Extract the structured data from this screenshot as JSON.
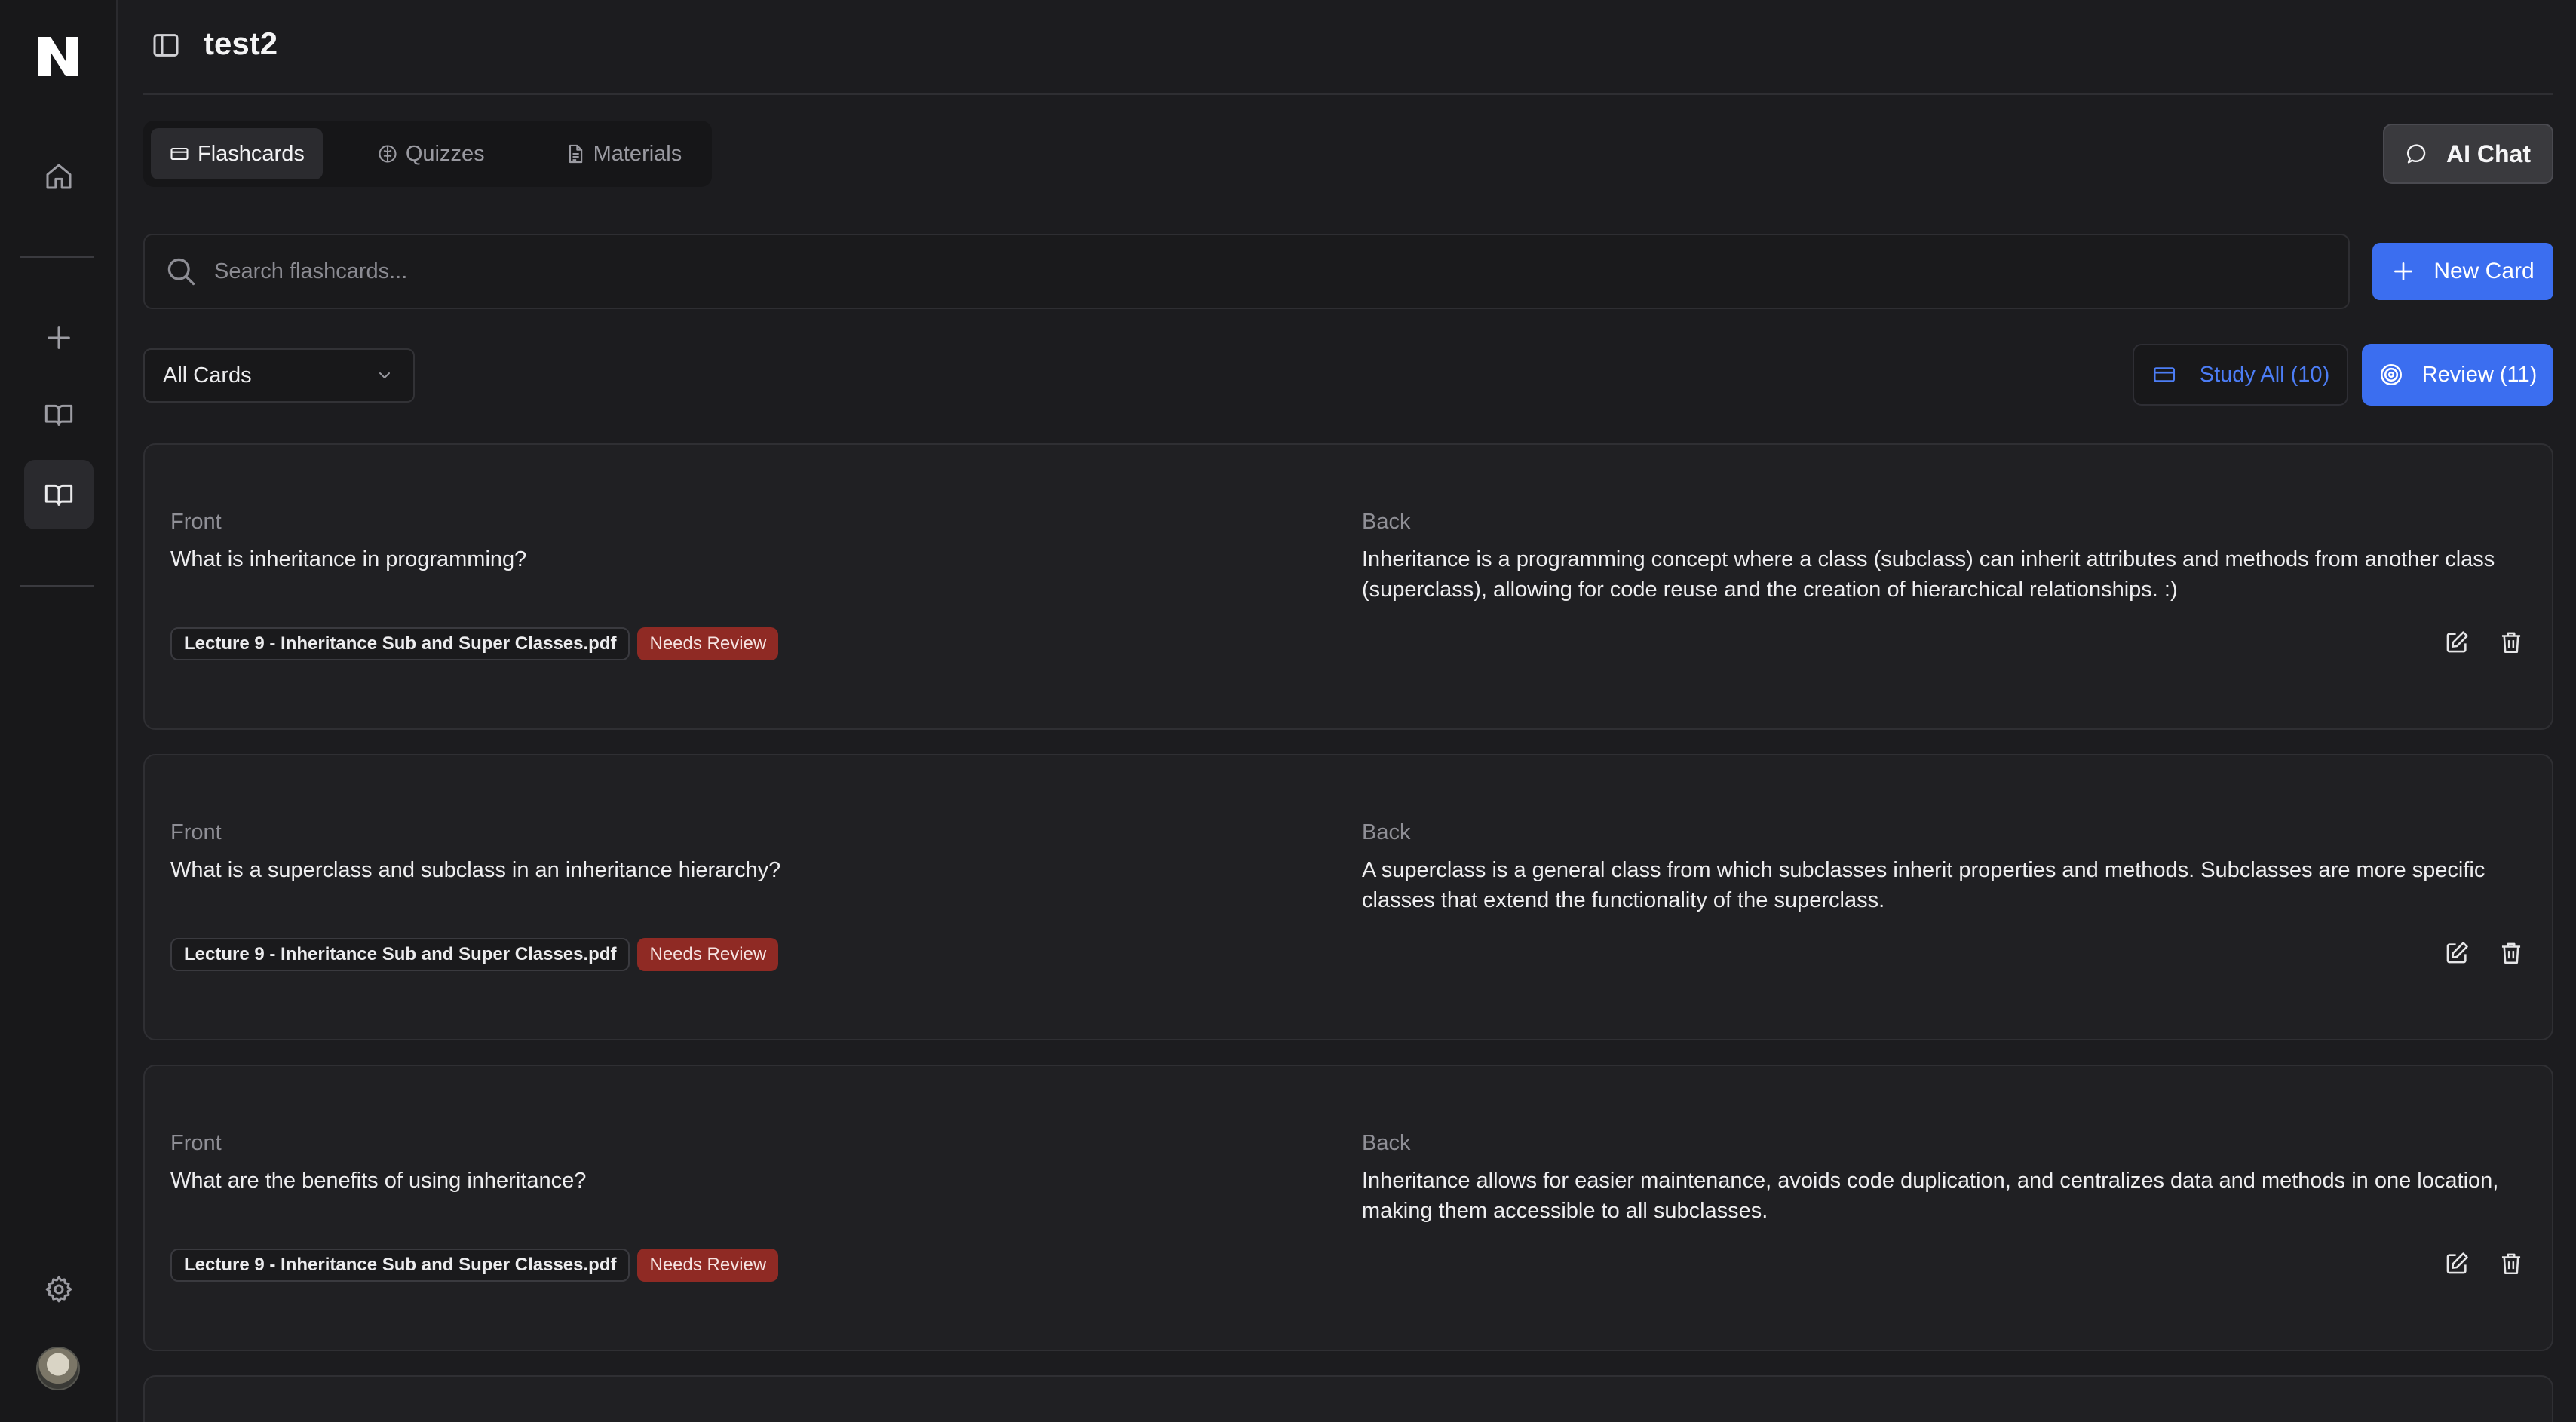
{
  "app": {
    "title": "test2"
  },
  "sidebar": {
    "items": [
      {
        "name": "home",
        "icon": "home-icon"
      },
      {
        "name": "add",
        "icon": "plus-icon"
      },
      {
        "name": "library",
        "icon": "book-open-icon"
      },
      {
        "name": "flashcards",
        "icon": "book-open-icon",
        "active": true
      }
    ],
    "bottom": [
      {
        "name": "settings",
        "icon": "gear-icon"
      },
      {
        "name": "avatar",
        "icon": "avatar"
      }
    ]
  },
  "tabs": [
    {
      "label": "Flashcards",
      "icon": "card-icon",
      "active": true
    },
    {
      "label": "Quizzes",
      "icon": "brain-icon",
      "active": false
    },
    {
      "label": "Materials",
      "icon": "document-icon",
      "active": false
    }
  ],
  "ai_chat": {
    "label": "AI Chat",
    "icon": "chat-bubble-icon"
  },
  "search": {
    "placeholder": "Search flashcards..."
  },
  "new_card": {
    "label": "New Card",
    "icon": "plus-icon"
  },
  "filter": {
    "selected": "All Cards"
  },
  "study_all": {
    "label": "Study All (10)",
    "icon": "card-icon"
  },
  "review": {
    "label": "Review (11)",
    "icon": "target-icon"
  },
  "cards": [
    {
      "front_label": "Front",
      "front": "What is inheritance in programming?",
      "back_label": "Back",
      "back": "Inheritance is a programming concept where a class (subclass) can inherit attributes and methods from another class (superclass), allowing for code reuse and the creation of hierarchical relationships. :)",
      "source": "Lecture 9 - Inheritance Sub and Super Classes.pdf",
      "status": "Needs Review"
    },
    {
      "front_label": "Front",
      "front": "What is a superclass and subclass in an inheritance hierarchy?",
      "back_label": "Back",
      "back": "A superclass is a general class from which subclasses inherit properties and methods. Subclasses are more specific classes that extend the functionality of the superclass.",
      "source": "Lecture 9 - Inheritance Sub and Super Classes.pdf",
      "status": "Needs Review"
    },
    {
      "front_label": "Front",
      "front": "What are the benefits of using inheritance?",
      "back_label": "Back",
      "back": "Inheritance allows for easier maintenance, avoids code duplication, and centralizes data and methods in one location, making them accessible to all subclasses.",
      "source": "Lecture 9 - Inheritance Sub and Super Classes.pdf",
      "status": "Needs Review"
    }
  ],
  "colors": {
    "background": "#1c1c1f",
    "accent": "#3b6ef0",
    "needs_review": "#8f2a24"
  }
}
